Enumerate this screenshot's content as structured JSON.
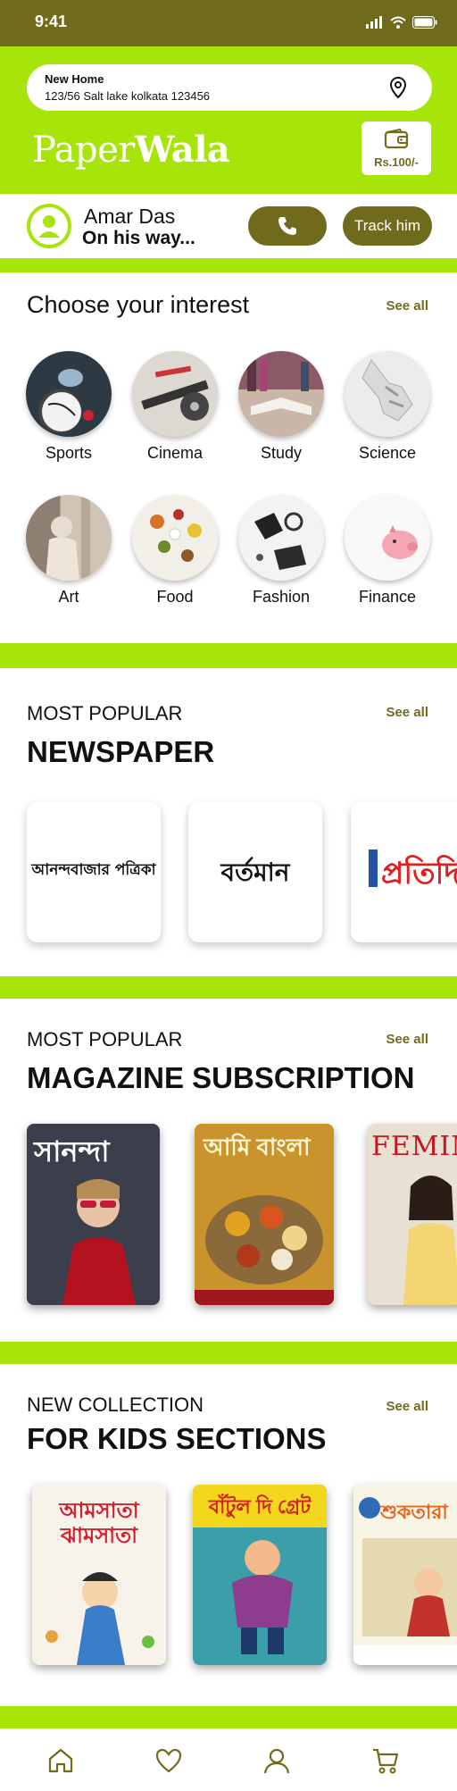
{
  "status": {
    "time": "9:41"
  },
  "address": {
    "title": "New Home",
    "line": "123/56 Salt lake kolkata 123456"
  },
  "brand": {
    "part1": "Paper",
    "part2": "Wala"
  },
  "wallet": {
    "amount": "Rs.100/-"
  },
  "delivery": {
    "name": "Amar Das",
    "status": "On his way...",
    "track_label": "Track him"
  },
  "interests": {
    "title": "Choose your interest",
    "see_all": "See all",
    "items": [
      "Sports",
      "Cinema",
      "Study",
      "Science",
      "Art",
      "Food",
      "Fashion",
      "Finance"
    ]
  },
  "newspaper": {
    "kicker": "MOST POPULAR",
    "title": "NEWSPAPER",
    "see_all": "See all",
    "items": [
      "আনন্দবাজার পত্রিকা",
      "বর্তমান",
      "প্রতিদি"
    ]
  },
  "magazines": {
    "kicker": "MOST POPULAR",
    "title": "MAGAZINE SUBSCRIPTION",
    "see_all": "See all",
    "items": [
      "সানন্দা",
      "আমি বাংলা",
      "FEMINA"
    ]
  },
  "kids": {
    "kicker": "NEW COLLECTION",
    "title": "FOR KIDS SECTIONS",
    "see_all": "See all",
    "items": [
      "আমসাতা ঝামসাতা",
      "বাঁটুল দি গ্রেট",
      "শুকতারা"
    ]
  },
  "colors": {
    "lime": "#a6e40a",
    "olive": "#706b1c"
  },
  "nav_icons": [
    "home-icon",
    "heart-icon",
    "user-icon",
    "cart-icon"
  ]
}
